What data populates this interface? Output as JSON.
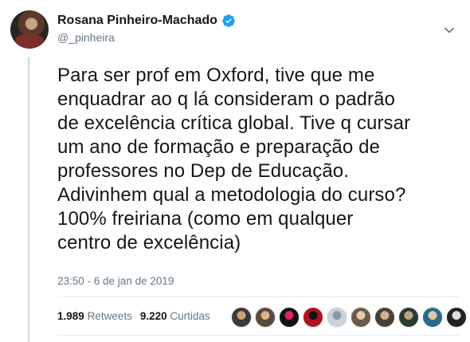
{
  "author": {
    "name": "Rosana Pinheiro-Machado",
    "handle": "@_pinheira",
    "verified": true
  },
  "tweet": {
    "text_lines": [
      "Para ser prof em Oxford, tive que me",
      "enquadrar ao q lá consideram o padrão",
      "de excelência crítica global. Tive q cursar",
      "um ano de formação e preparação de",
      "professores no Dep de Educação.",
      "Adivinhem qual a metodologia do curso?",
      "100% freiriana (como em qualquer",
      "centro de excelência)"
    ],
    "timestamp": "23:50 - 6 de jan de 2019"
  },
  "stats": {
    "retweets_count": "1.989",
    "retweets_label": "Retweets",
    "likes_count": "9.220",
    "likes_label": "Curtidas"
  },
  "icons": {
    "verified": "verified-badge-icon",
    "menu": "chevron-down-icon"
  },
  "colors": {
    "accent": "#1da1f2",
    "muted": "#657786",
    "text": "#14171a",
    "border": "#e6ecf0"
  },
  "liker_avatars": [
    {
      "bg": "#3a3a3a",
      "fg": "#c8a07a"
    },
    {
      "bg": "#5b4a3a",
      "fg": "#d9b38c"
    },
    {
      "bg": "#111111",
      "fg": "#e0245e"
    },
    {
      "bg": "#b0121f",
      "fg": "#111111"
    },
    {
      "bg": "#c9d1d9",
      "fg": "#8899a6"
    },
    {
      "bg": "#6d5a4c",
      "fg": "#e7c9a9"
    },
    {
      "bg": "#4a4036",
      "fg": "#d3b08e"
    },
    {
      "bg": "#2f3a2f",
      "fg": "#b9a389"
    },
    {
      "bg": "#2b6c8a",
      "fg": "#e8c6a2"
    },
    {
      "bg": "#222222",
      "fg": "#dddddd"
    }
  ]
}
